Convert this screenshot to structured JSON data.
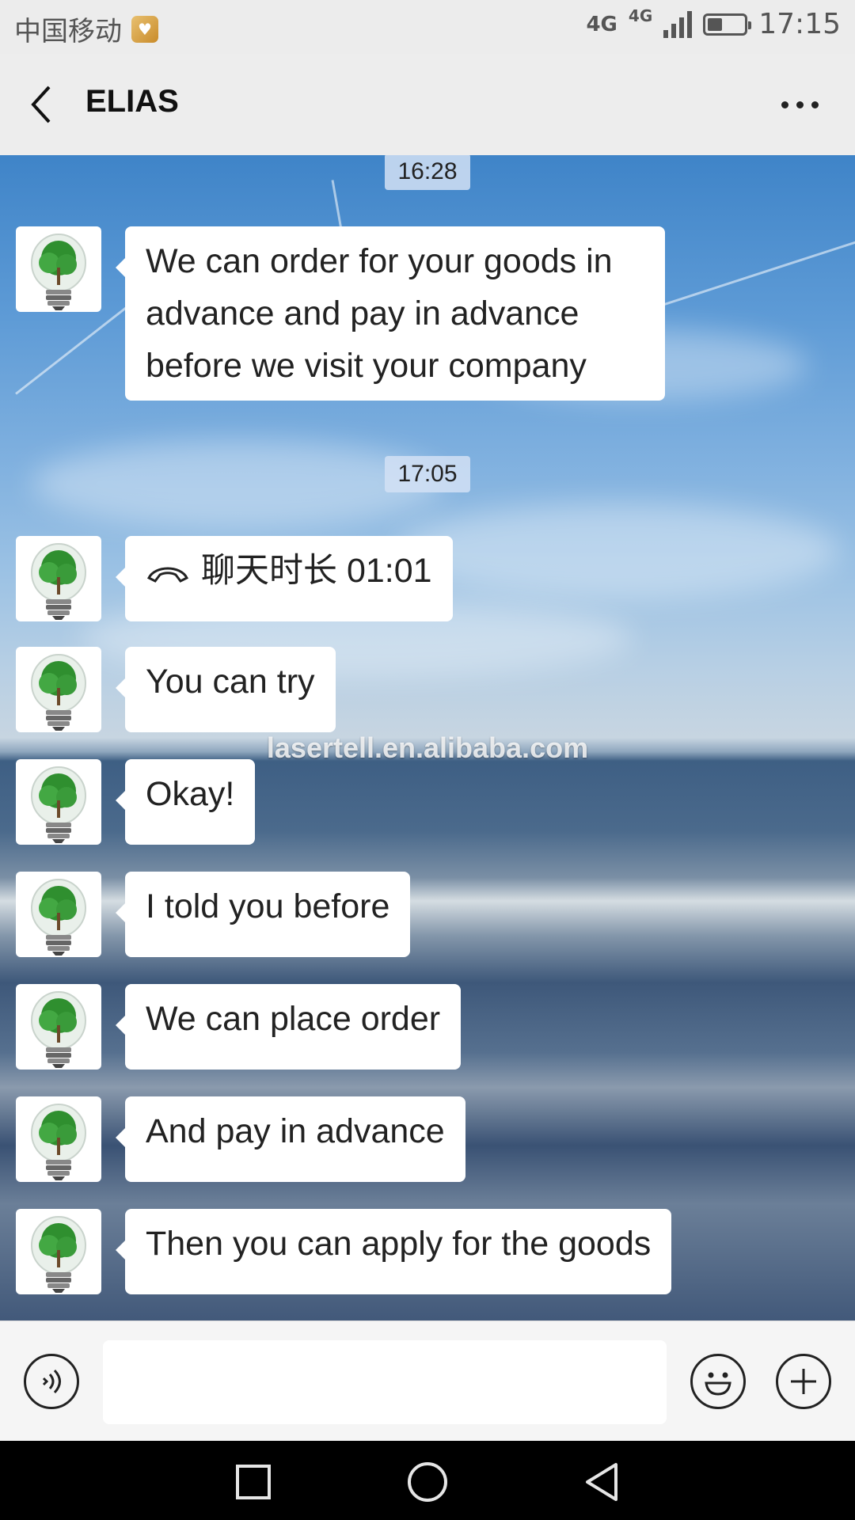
{
  "status_bar": {
    "carrier": "中国移动",
    "network_1": "4G",
    "network_2": "4G",
    "battery_level": 0.4,
    "time": "17:15"
  },
  "header": {
    "title": "ELIAS"
  },
  "watermark": "lasertell.en.alibaba.com",
  "timestamps": [
    "16:28",
    "17:05"
  ],
  "messages": [
    {
      "text": "We can order for your goods in advance and pay in advance before we visit your company"
    },
    {
      "text": "聊天时长 01:01",
      "icon": "phone-hangup-icon"
    },
    {
      "text": "You can try"
    },
    {
      "text": "Okay!"
    },
    {
      "text": "I told you before"
    },
    {
      "text": "We can place order"
    },
    {
      "text": "And pay in advance"
    },
    {
      "text": "Then you can apply for the goods"
    }
  ],
  "input": {
    "value": "",
    "placeholder": ""
  },
  "icons": {
    "back": "chevron-left-icon",
    "more": "more-dots-icon",
    "voice": "voice-icon",
    "emoji": "emoji-icon",
    "plus": "plus-icon",
    "nav_recent": "square-icon",
    "nav_home": "circle-icon",
    "nav_back": "triangle-back-icon"
  }
}
